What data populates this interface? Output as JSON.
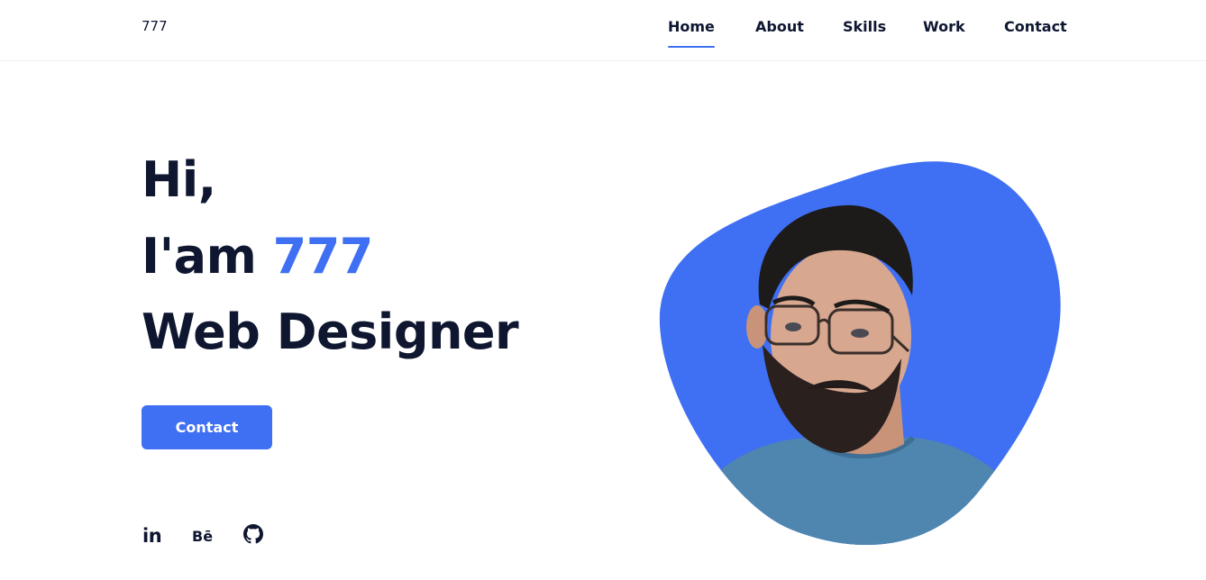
{
  "header": {
    "logo": "777",
    "nav": [
      "Home",
      "About",
      "Skills",
      "Work",
      "Contact"
    ],
    "active_nav": "Home"
  },
  "hero": {
    "greeting": "Hi,",
    "intro": "I'am",
    "name": "777",
    "title": "Web Designer",
    "cta_label": "Contact"
  },
  "social": {
    "linkedin_label": "in",
    "behance_label": "Bē",
    "github_icon": "github-icon"
  },
  "colors": {
    "accent": "#3f6ff2",
    "text": "#0e1630",
    "background": "#ffffff"
  }
}
